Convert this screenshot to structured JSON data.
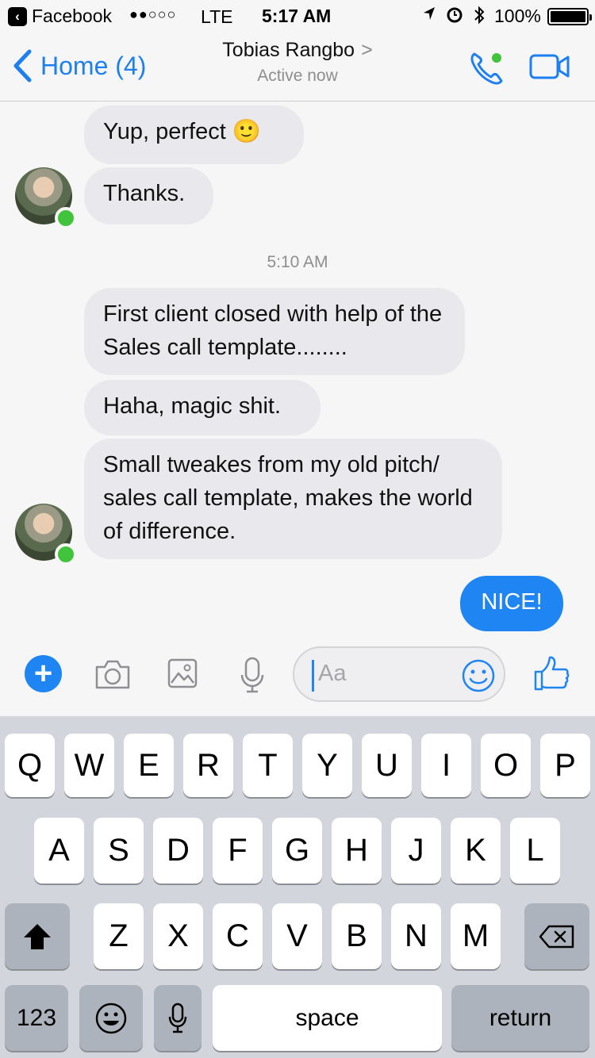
{
  "status_bar": {
    "back_app": "Facebook",
    "signal": "●●○○○",
    "carrier": "LTE",
    "time": "5:17 AM",
    "battery": "100%"
  },
  "nav": {
    "back_label": "Home (4)",
    "title": "Tobias Rangbo",
    "subtitle": "Active now",
    "title_chevron": ">"
  },
  "thread": {
    "messages": [
      {
        "text": "Yup, perfect 🙂",
        "direction": "in"
      },
      {
        "text": "Thanks.",
        "direction": "in"
      },
      {
        "text": "First client closed with help of the Sales call template........",
        "direction": "in"
      },
      {
        "text": "Haha, magic shit.",
        "direction": "in"
      },
      {
        "text": "Small tweakes from my old pitch/ sales call template, makes the world of difference.",
        "direction": "in"
      },
      {
        "text": "NICE!",
        "direction": "out"
      }
    ],
    "timestamp": "5:10 AM"
  },
  "composer": {
    "plus": "+",
    "placeholder": "Aa"
  },
  "keyboard": {
    "row1": [
      "Q",
      "W",
      "E",
      "R",
      "T",
      "Y",
      "U",
      "I",
      "O",
      "P"
    ],
    "row2": [
      "A",
      "S",
      "D",
      "F",
      "G",
      "H",
      "J",
      "K",
      "L"
    ],
    "row3": [
      "Z",
      "X",
      "C",
      "V",
      "B",
      "N",
      "M"
    ],
    "numbers": "123",
    "space": "space",
    "return": "return"
  },
  "colors": {
    "accent": "#1e85f2",
    "incoming_bubble": "#e9e8ed",
    "online": "#41c33b"
  }
}
